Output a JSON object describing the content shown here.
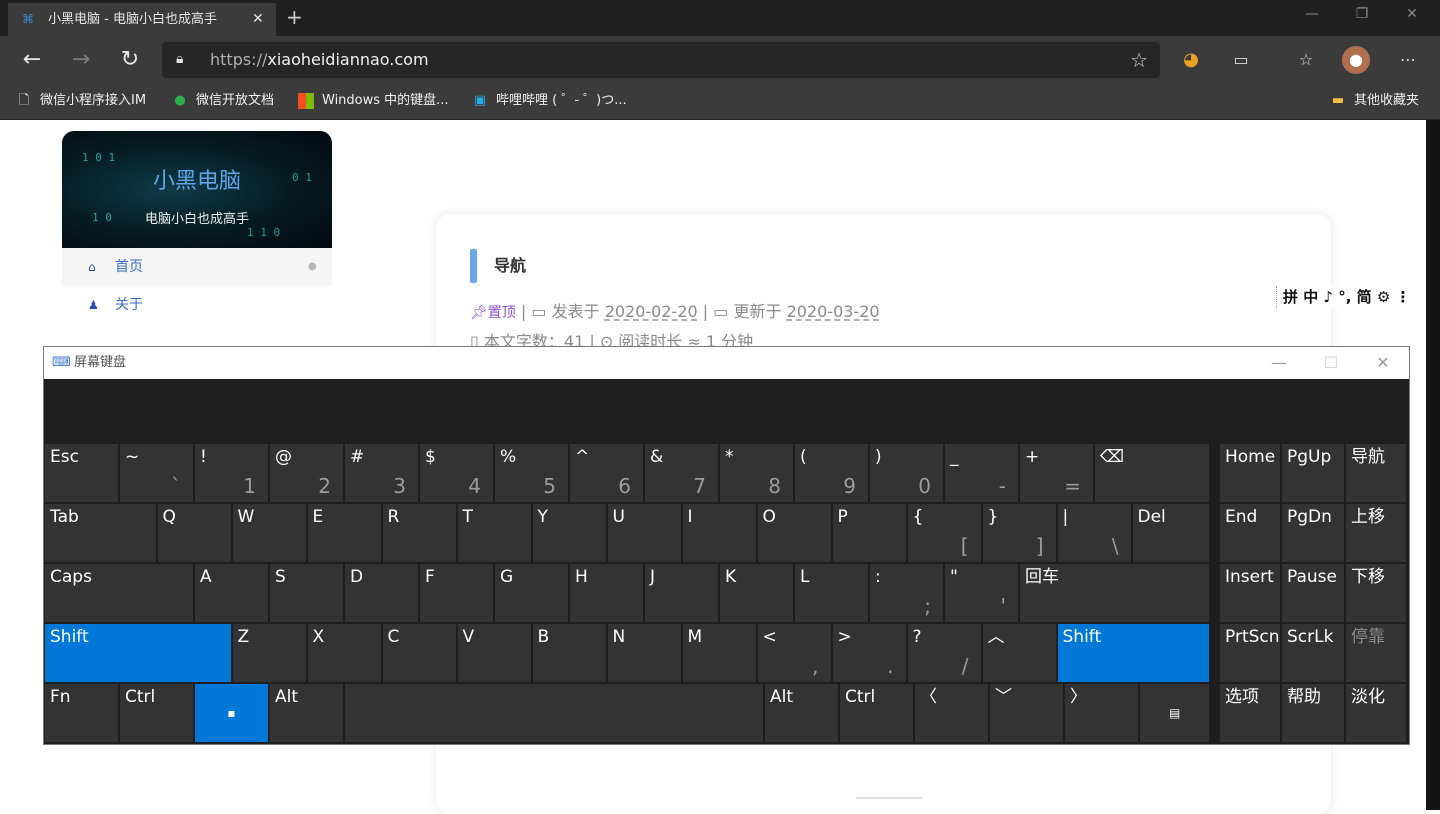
{
  "browser": {
    "tab_title": "小黑电脑 - 电脑小白也成高手",
    "tab_close": "✕",
    "new_tab": "+",
    "url_prefix": "https://",
    "url_host": "xiaoheidiannao.com",
    "bookmarks": [
      {
        "icon": "file-icon",
        "glyph": "🗋",
        "label": "微信小程序接入IM"
      },
      {
        "icon": "wechat-icon",
        "glyph": "●",
        "label": "微信开放文档"
      },
      {
        "icon": "windows-icon",
        "glyph": "■",
        "label": "Windows 中的键盘..."
      },
      {
        "icon": "bilibili-icon",
        "glyph": "▣",
        "label": "哔哩哔哩 ( ゜- ゜)つ..."
      }
    ],
    "other_bookmarks": "其他收藏夹"
  },
  "site": {
    "brand_name": "小黑电脑",
    "brand_tagline": "电脑小白也成高手",
    "menu": [
      {
        "icon": "home-icon",
        "glyph": "⌂",
        "label": "首页"
      },
      {
        "icon": "user-icon",
        "glyph": "♟",
        "label": "关于"
      }
    ]
  },
  "post": {
    "title": "导航",
    "pin_label": "置顶",
    "published_label": "发表于",
    "published_date": "2020-02-20",
    "updated_label": "更新于",
    "updated_date": "2020-03-20",
    "meta_line2": "本文字数：41 | ⊙ 阅读时长 ≈ 1 分钟"
  },
  "ime": {
    "text": "拼 中 ♪ °, 简 ⚙ ⋮"
  },
  "osk": {
    "title": "屏幕键盘",
    "rows": [
      [
        {
          "p": "Esc",
          "x": 0,
          "w": 1
        },
        {
          "p": "~",
          "s": "`",
          "x": 1,
          "w": 1
        },
        {
          "p": "!",
          "s": "1",
          "x": 2,
          "w": 1
        },
        {
          "p": "@",
          "s": "2",
          "x": 3,
          "w": 1
        },
        {
          "p": "#",
          "s": "3",
          "x": 4,
          "w": 1
        },
        {
          "p": "$",
          "s": "4",
          "x": 5,
          "w": 1
        },
        {
          "p": "%",
          "s": "5",
          "x": 6,
          "w": 1
        },
        {
          "p": "^",
          "s": "6",
          "x": 7,
          "w": 1
        },
        {
          "p": "&",
          "s": "7",
          "x": 8,
          "w": 1
        },
        {
          "p": "*",
          "s": "8",
          "x": 9,
          "w": 1
        },
        {
          "p": "(",
          "s": "9",
          "x": 10,
          "w": 1
        },
        {
          "p": ")",
          "s": "0",
          "x": 11,
          "w": 1
        },
        {
          "p": "_",
          "s": "-",
          "x": 12,
          "w": 1
        },
        {
          "p": "+",
          "s": "=",
          "x": 13,
          "w": 1
        },
        {
          "p": "⌫",
          "x": 14,
          "w": 1.55,
          "name": "backspace"
        }
      ],
      [
        {
          "p": "Tab",
          "x": 0,
          "w": 1.5
        },
        {
          "p": "Q",
          "x": 1.5,
          "w": 1
        },
        {
          "p": "W",
          "x": 2.5,
          "w": 1
        },
        {
          "p": "E",
          "x": 3.5,
          "w": 1
        },
        {
          "p": "R",
          "x": 4.5,
          "w": 1
        },
        {
          "p": "T",
          "x": 5.5,
          "w": 1
        },
        {
          "p": "Y",
          "x": 6.5,
          "w": 1
        },
        {
          "p": "U",
          "x": 7.5,
          "w": 1
        },
        {
          "p": "I",
          "x": 8.5,
          "w": 1
        },
        {
          "p": "O",
          "x": 9.5,
          "w": 1
        },
        {
          "p": "P",
          "x": 10.5,
          "w": 1
        },
        {
          "p": "{",
          "s": "[",
          "x": 11.5,
          "w": 1
        },
        {
          "p": "}",
          "s": "]",
          "x": 12.5,
          "w": 1
        },
        {
          "p": "|",
          "s": "\\",
          "x": 13.5,
          "w": 1
        },
        {
          "p": "Del",
          "x": 14.5,
          "w": 1.05
        }
      ],
      [
        {
          "p": "Caps",
          "x": 0,
          "w": 2
        },
        {
          "p": "A",
          "x": 2,
          "w": 1
        },
        {
          "p": "S",
          "x": 3,
          "w": 1
        },
        {
          "p": "D",
          "x": 4,
          "w": 1
        },
        {
          "p": "F",
          "x": 5,
          "w": 1
        },
        {
          "p": "G",
          "x": 6,
          "w": 1
        },
        {
          "p": "H",
          "x": 7,
          "w": 1
        },
        {
          "p": "J",
          "x": 8,
          "w": 1
        },
        {
          "p": "K",
          "x": 9,
          "w": 1
        },
        {
          "p": "L",
          "x": 10,
          "w": 1
        },
        {
          "p": ":",
          "s": ";",
          "x": 11,
          "w": 1
        },
        {
          "p": "\"",
          "s": "'",
          "x": 12,
          "w": 1
        },
        {
          "p": "回车",
          "x": 13,
          "w": 2.55
        }
      ],
      [
        {
          "p": "Shift",
          "x": 0,
          "w": 2.5,
          "blue": true,
          "name": "shift-left"
        },
        {
          "p": "Z",
          "x": 2.5,
          "w": 1
        },
        {
          "p": "X",
          "x": 3.5,
          "w": 1
        },
        {
          "p": "C",
          "x": 4.5,
          "w": 1
        },
        {
          "p": "V",
          "x": 5.5,
          "w": 1
        },
        {
          "p": "B",
          "x": 6.5,
          "w": 1
        },
        {
          "p": "N",
          "x": 7.5,
          "w": 1
        },
        {
          "p": "M",
          "x": 8.5,
          "w": 1
        },
        {
          "p": "<",
          "s": ",",
          "x": 9.5,
          "w": 1
        },
        {
          "p": ">",
          "s": ".",
          "x": 10.5,
          "w": 1
        },
        {
          "p": "?",
          "s": "/",
          "x": 11.5,
          "w": 1
        },
        {
          "p": "︿",
          "x": 12.5,
          "w": 1,
          "name": "arrow-up"
        },
        {
          "p": "Shift",
          "x": 13.5,
          "w": 2.05,
          "blue": true,
          "name": "shift-right"
        }
      ],
      [
        {
          "p": "Fn",
          "x": 0,
          "w": 1
        },
        {
          "p": "Ctrl",
          "x": 1,
          "w": 1
        },
        {
          "p": "▪",
          "x": 2,
          "w": 1,
          "blue": true,
          "center": true,
          "name": "windows"
        },
        {
          "p": "Alt",
          "x": 3,
          "w": 1
        },
        {
          "p": "",
          "x": 4,
          "w": 5.6,
          "name": "space"
        },
        {
          "p": "Alt",
          "x": 9.6,
          "w": 1,
          "name": "alt-right"
        },
        {
          "p": "Ctrl",
          "x": 10.6,
          "w": 1,
          "name": "ctrl-right"
        },
        {
          "p": "〈",
          "x": 11.6,
          "w": 1,
          "name": "arrow-left"
        },
        {
          "p": "﹀",
          "x": 12.6,
          "w": 1,
          "name": "arrow-down"
        },
        {
          "p": "〉",
          "x": 13.6,
          "w": 1,
          "name": "arrow-right"
        },
        {
          "p": "▤",
          "x": 14.6,
          "w": 0.95,
          "center": true,
          "name": "menu"
        }
      ]
    ],
    "side": [
      [
        "Home",
        "PgUp",
        "导航"
      ],
      [
        "End",
        "PgDn",
        "上移"
      ],
      [
        "Insert",
        "Pause",
        "下移"
      ],
      [
        "PrtScn",
        "ScrLk",
        "停靠"
      ],
      [
        "选项",
        "帮助",
        "淡化"
      ]
    ],
    "dimmed_key": "停靠"
  },
  "colors": {
    "accent_blue": "#0078d7",
    "key_bg": "#333333",
    "osk_bg": "#1e1e1e"
  }
}
